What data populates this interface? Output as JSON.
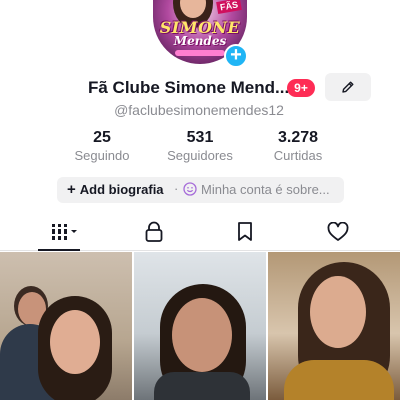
{
  "profile": {
    "avatar_logo_line1": "SIMONE",
    "avatar_logo_line2": "Mendes",
    "avatar_badge": "FÃS",
    "add_icon": "plus-icon",
    "name": "Fã Clube Simone Mend...",
    "notification_count": "9+",
    "edit_icon": "pencil-icon",
    "handle": "@faclubesimonemendes12"
  },
  "stats": [
    {
      "value": "25",
      "label": "Seguindo"
    },
    {
      "value": "531",
      "label": "Seguidores"
    },
    {
      "value": "3.278",
      "label": "Curtidas"
    }
  ],
  "bio": {
    "add_label": "Add biografia",
    "separator": "·",
    "account_label": "Minha conta é sobre..."
  },
  "tabs": [
    {
      "name": "videos",
      "icon": "grid-icon",
      "active": true
    },
    {
      "name": "private",
      "icon": "lock-icon"
    },
    {
      "name": "favorites",
      "icon": "bookmark-icon"
    },
    {
      "name": "liked",
      "icon": "heart-icon"
    }
  ],
  "colors": {
    "accent_red": "#fe2c55",
    "add_blue": "#20b5f5",
    "text_primary": "#161823",
    "text_secondary": "#8a8b91"
  }
}
